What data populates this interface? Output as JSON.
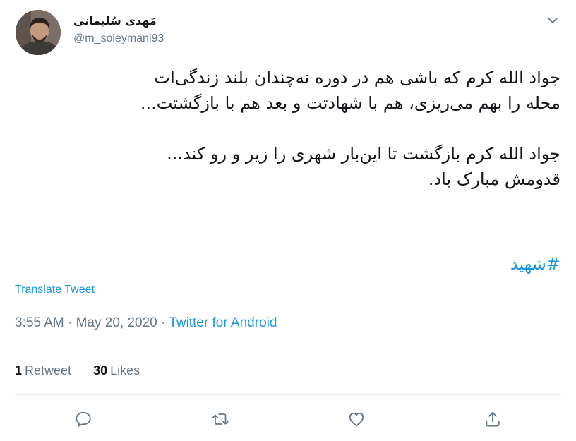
{
  "author": {
    "display_name": "مَهدی سُلیمانی",
    "username": "@m_soleymani93"
  },
  "tweet": {
    "lines": [
      "جواد الله کرم که باشی هم در دوره نه‌چندان بلند زندگی‌ات",
      "محله را بهم می‌ریزی، هم با شهادتت و بعد هم با بازگشتت...",
      "جواد الله کرم بازگشت تا این‌بار شهری را زیر و رو کند...",
      "قدومش مبارک باد."
    ],
    "hashtag": "#شهید",
    "translate_label": "Translate Tweet"
  },
  "meta": {
    "time": "3:55 AM",
    "separator": "·",
    "date": "May 20, 2020",
    "source": "Twitter for Android"
  },
  "stats": {
    "retweets_count": "1",
    "retweets_label": "Retweet",
    "likes_count": "30",
    "likes_label": "Likes"
  },
  "icons": {
    "caret": "chevron-down-icon",
    "reply": "reply-icon",
    "retweet": "retweet-icon",
    "like": "heart-icon",
    "share": "share-icon"
  },
  "colors": {
    "link": "#1b95e0",
    "secondary_text": "#657786",
    "primary_text": "#14171a",
    "divider": "#e6ecf0"
  }
}
